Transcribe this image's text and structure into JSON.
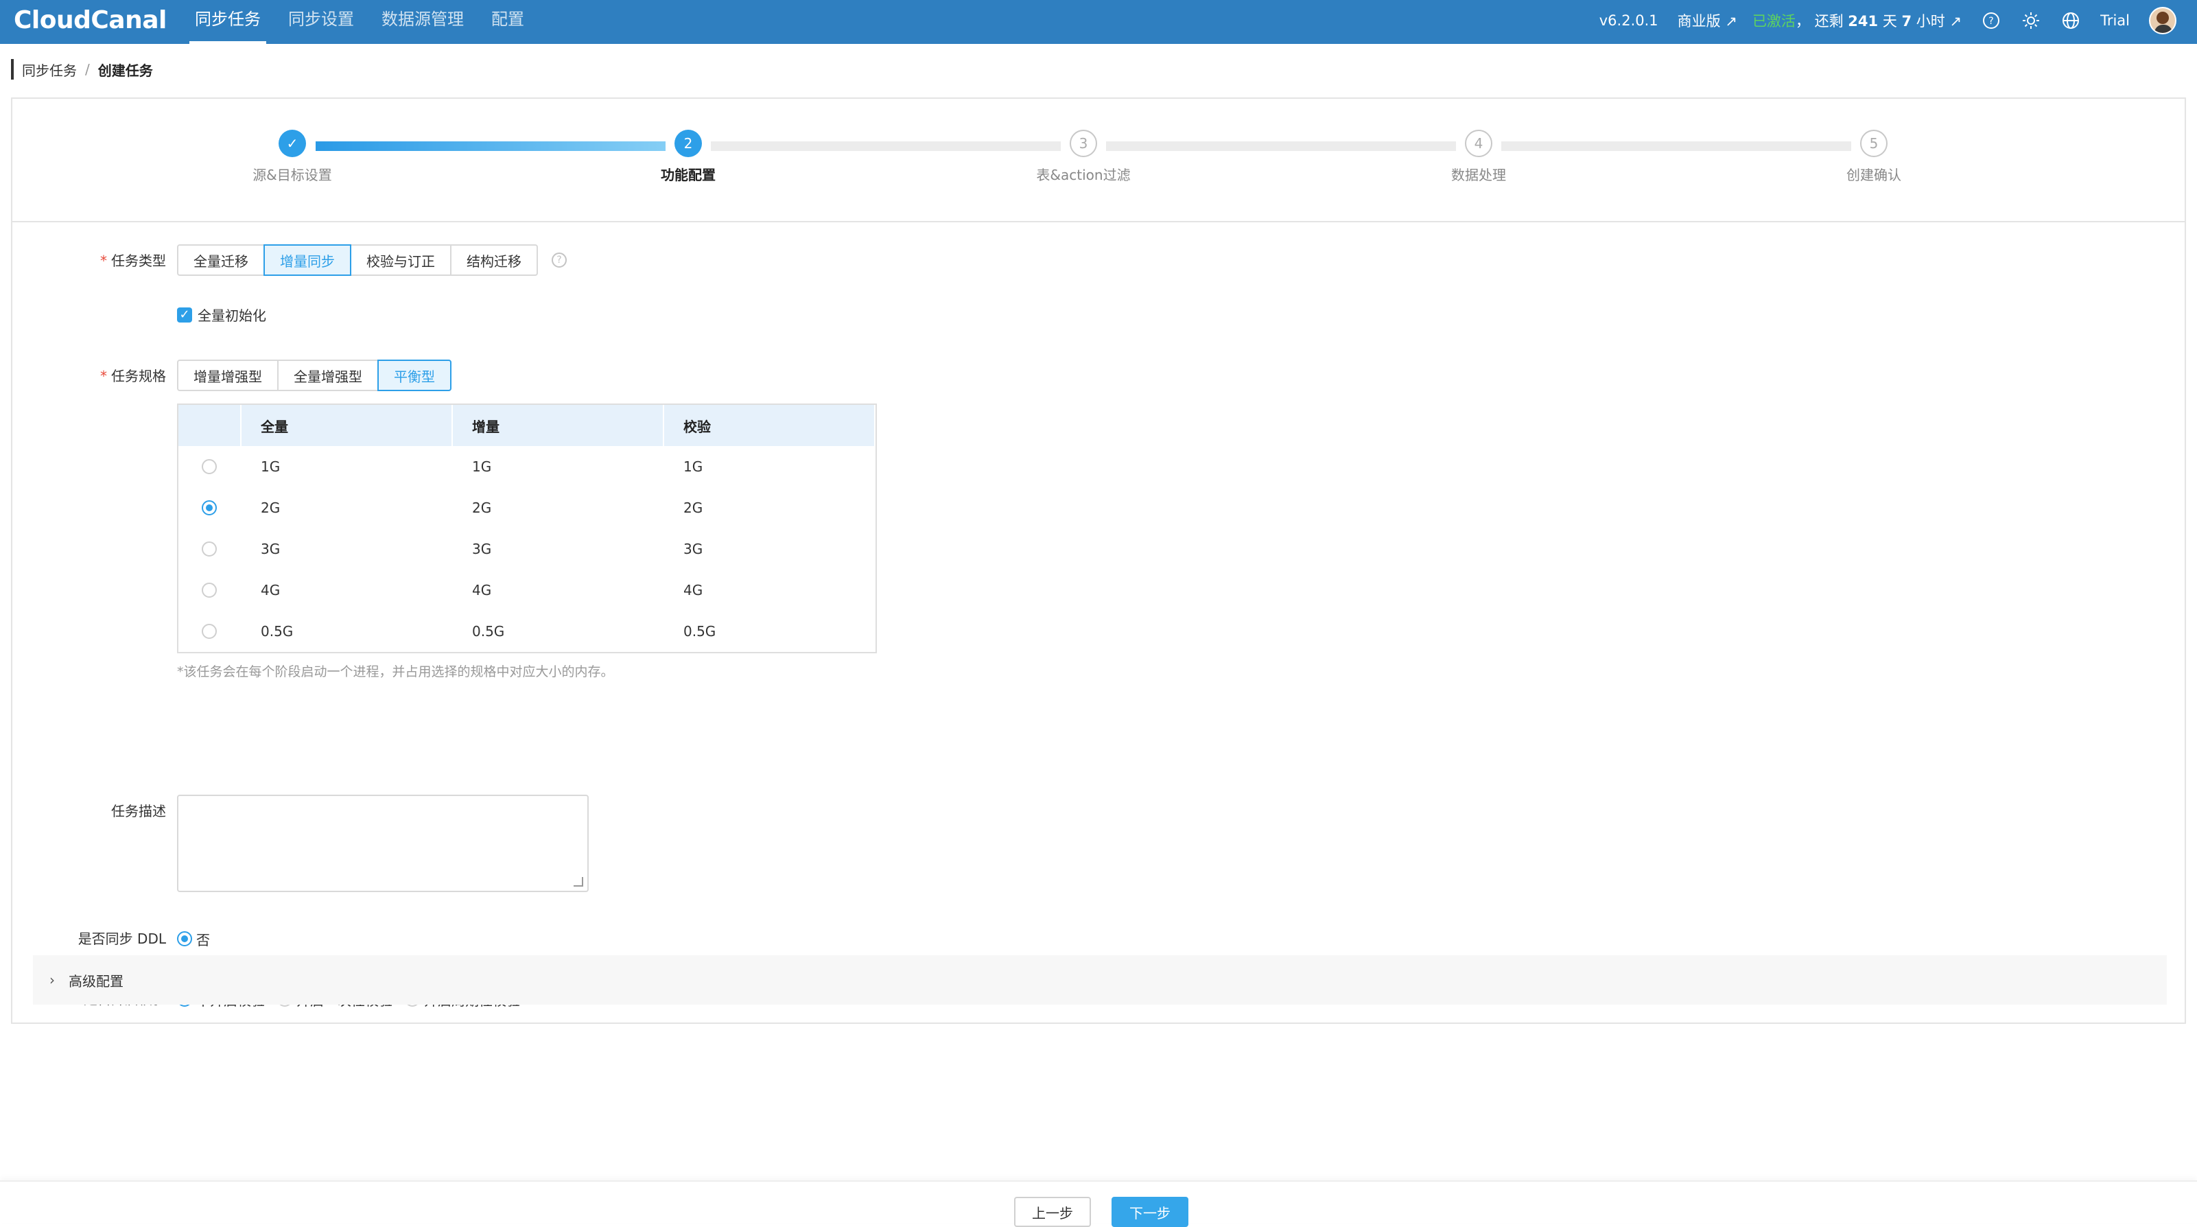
{
  "brand": {
    "logo": "CloudCanal"
  },
  "nav": [
    {
      "label": "同步任务",
      "active": true
    },
    {
      "label": "同步设置"
    },
    {
      "label": "数据源管理"
    },
    {
      "label": "配置"
    }
  ],
  "topbar": {
    "version": "v6.2.0.1",
    "edition": "商业版 ↗",
    "activated": "已激活",
    "remain_prefix": "， 还剩 ",
    "remain_days": "241",
    "remain_mid": " 天 ",
    "remain_hours": "7",
    "remain_suffix": " 小时 ↗",
    "user": "Trial"
  },
  "breadcrumb": {
    "parent": "同步任务",
    "separator": "/",
    "current": "创建任务"
  },
  "steps": [
    {
      "label": "源&目标设置",
      "num": "✓",
      "state": "done"
    },
    {
      "label": "功能配置",
      "num": "2",
      "state": "current"
    },
    {
      "label": "表&action过滤",
      "num": "3",
      "state": "todo"
    },
    {
      "label": "数据处理",
      "num": "4",
      "state": "todo"
    },
    {
      "label": "创建确认",
      "num": "5",
      "state": "todo"
    }
  ],
  "form": {
    "task_type": {
      "label": "任务类型",
      "options": [
        "全量迁移",
        "增量同步",
        "校验与订正",
        "结构迁移"
      ],
      "selected": "增量同步"
    },
    "full_init": {
      "label": "全量初始化",
      "checked": true
    },
    "task_spec": {
      "label": "任务规格",
      "options": [
        "增量增强型",
        "全量增强型",
        "平衡型"
      ],
      "selected": "平衡型",
      "table": {
        "headers": [
          "全量",
          "增量",
          "校验"
        ],
        "rows": [
          {
            "full": "1G",
            "incr": "1G",
            "check": "1G",
            "selected": false
          },
          {
            "full": "2G",
            "incr": "2G",
            "check": "2G",
            "selected": true
          },
          {
            "full": "3G",
            "incr": "3G",
            "check": "3G",
            "selected": false
          },
          {
            "full": "4G",
            "incr": "4G",
            "check": "4G",
            "selected": false
          },
          {
            "full": "0.5G",
            "incr": "0.5G",
            "check": "0.5G",
            "selected": false
          }
        ]
      },
      "note": "*该任务会在每个阶段启动一个进程，并占用选择的规格中对应大小的内存。"
    },
    "description": {
      "label": "任务描述",
      "value": ""
    },
    "sync_ddl": {
      "label": "是否同步 DDL",
      "options": [
        "否"
      ],
      "selected": "否"
    },
    "verify": {
      "label": "是否开启校验",
      "options": [
        "不开启校验",
        "开启一次性校验",
        "开启周期性校验"
      ],
      "selected": "不开启校验"
    },
    "advanced": {
      "label": "高级配置"
    }
  },
  "footer": {
    "prev": "上一步",
    "next": "下一步"
  },
  "colors": {
    "primary": "#2d9fe8",
    "topbar": "#2f7fc0",
    "activated": "#5ed35e"
  }
}
